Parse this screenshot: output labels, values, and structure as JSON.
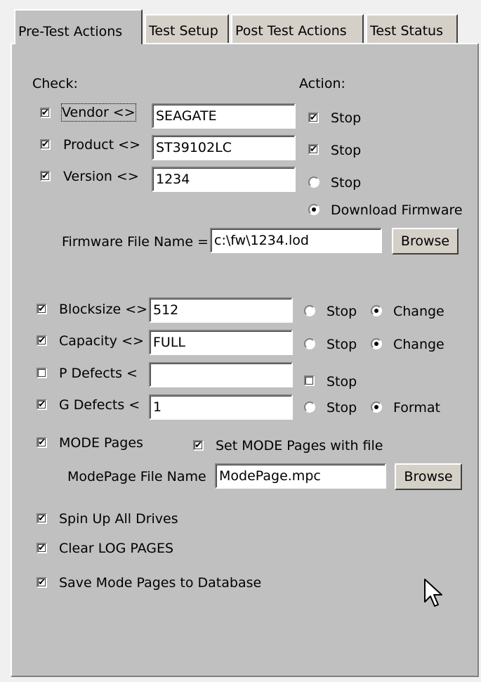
{
  "tabs": [
    "Pre-Test Actions",
    "Test Setup",
    "Post Test Actions",
    "Test Status"
  ],
  "check_label": "Check:",
  "action_label": "Action:",
  "vendor": {
    "label": "Vendor <>",
    "value": "SEAGATE",
    "checked": true,
    "action": "Stop"
  },
  "product": {
    "label": "Product <>",
    "value": "ST39102LC",
    "checked": true,
    "action": "Stop"
  },
  "version": {
    "label": "Version <>",
    "value": "1234",
    "checked": true,
    "action_stop": "Stop",
    "action_download": "Download Firmware"
  },
  "firmware": {
    "label": "Firmware File Name =",
    "value": "c:\\fw\\1234.lod",
    "browse": "Browse"
  },
  "blocksize": {
    "label": "Blocksize <>",
    "value": "512",
    "stop": "Stop",
    "change": "Change"
  },
  "capacity": {
    "label": "Capacity <>",
    "value": "FULL",
    "stop": "Stop",
    "change": "Change"
  },
  "p_defects": {
    "label": "P Defects <",
    "value": "",
    "stop": "Stop"
  },
  "g_defects": {
    "label": "G Defects <",
    "value": "1",
    "stop": "Stop",
    "format": "Format"
  },
  "mode_pages": {
    "label": "MODE Pages",
    "set_label": "Set MODE Pages with file"
  },
  "modepage_file": {
    "label": "ModePage File Name",
    "value": "ModePage.mpc",
    "browse": "Browse"
  },
  "spin_up": "Spin Up All Drives",
  "clear_log": "Clear LOG PAGES",
  "save_mode": "Save Mode Pages to Database",
  "check_mark": "✔"
}
